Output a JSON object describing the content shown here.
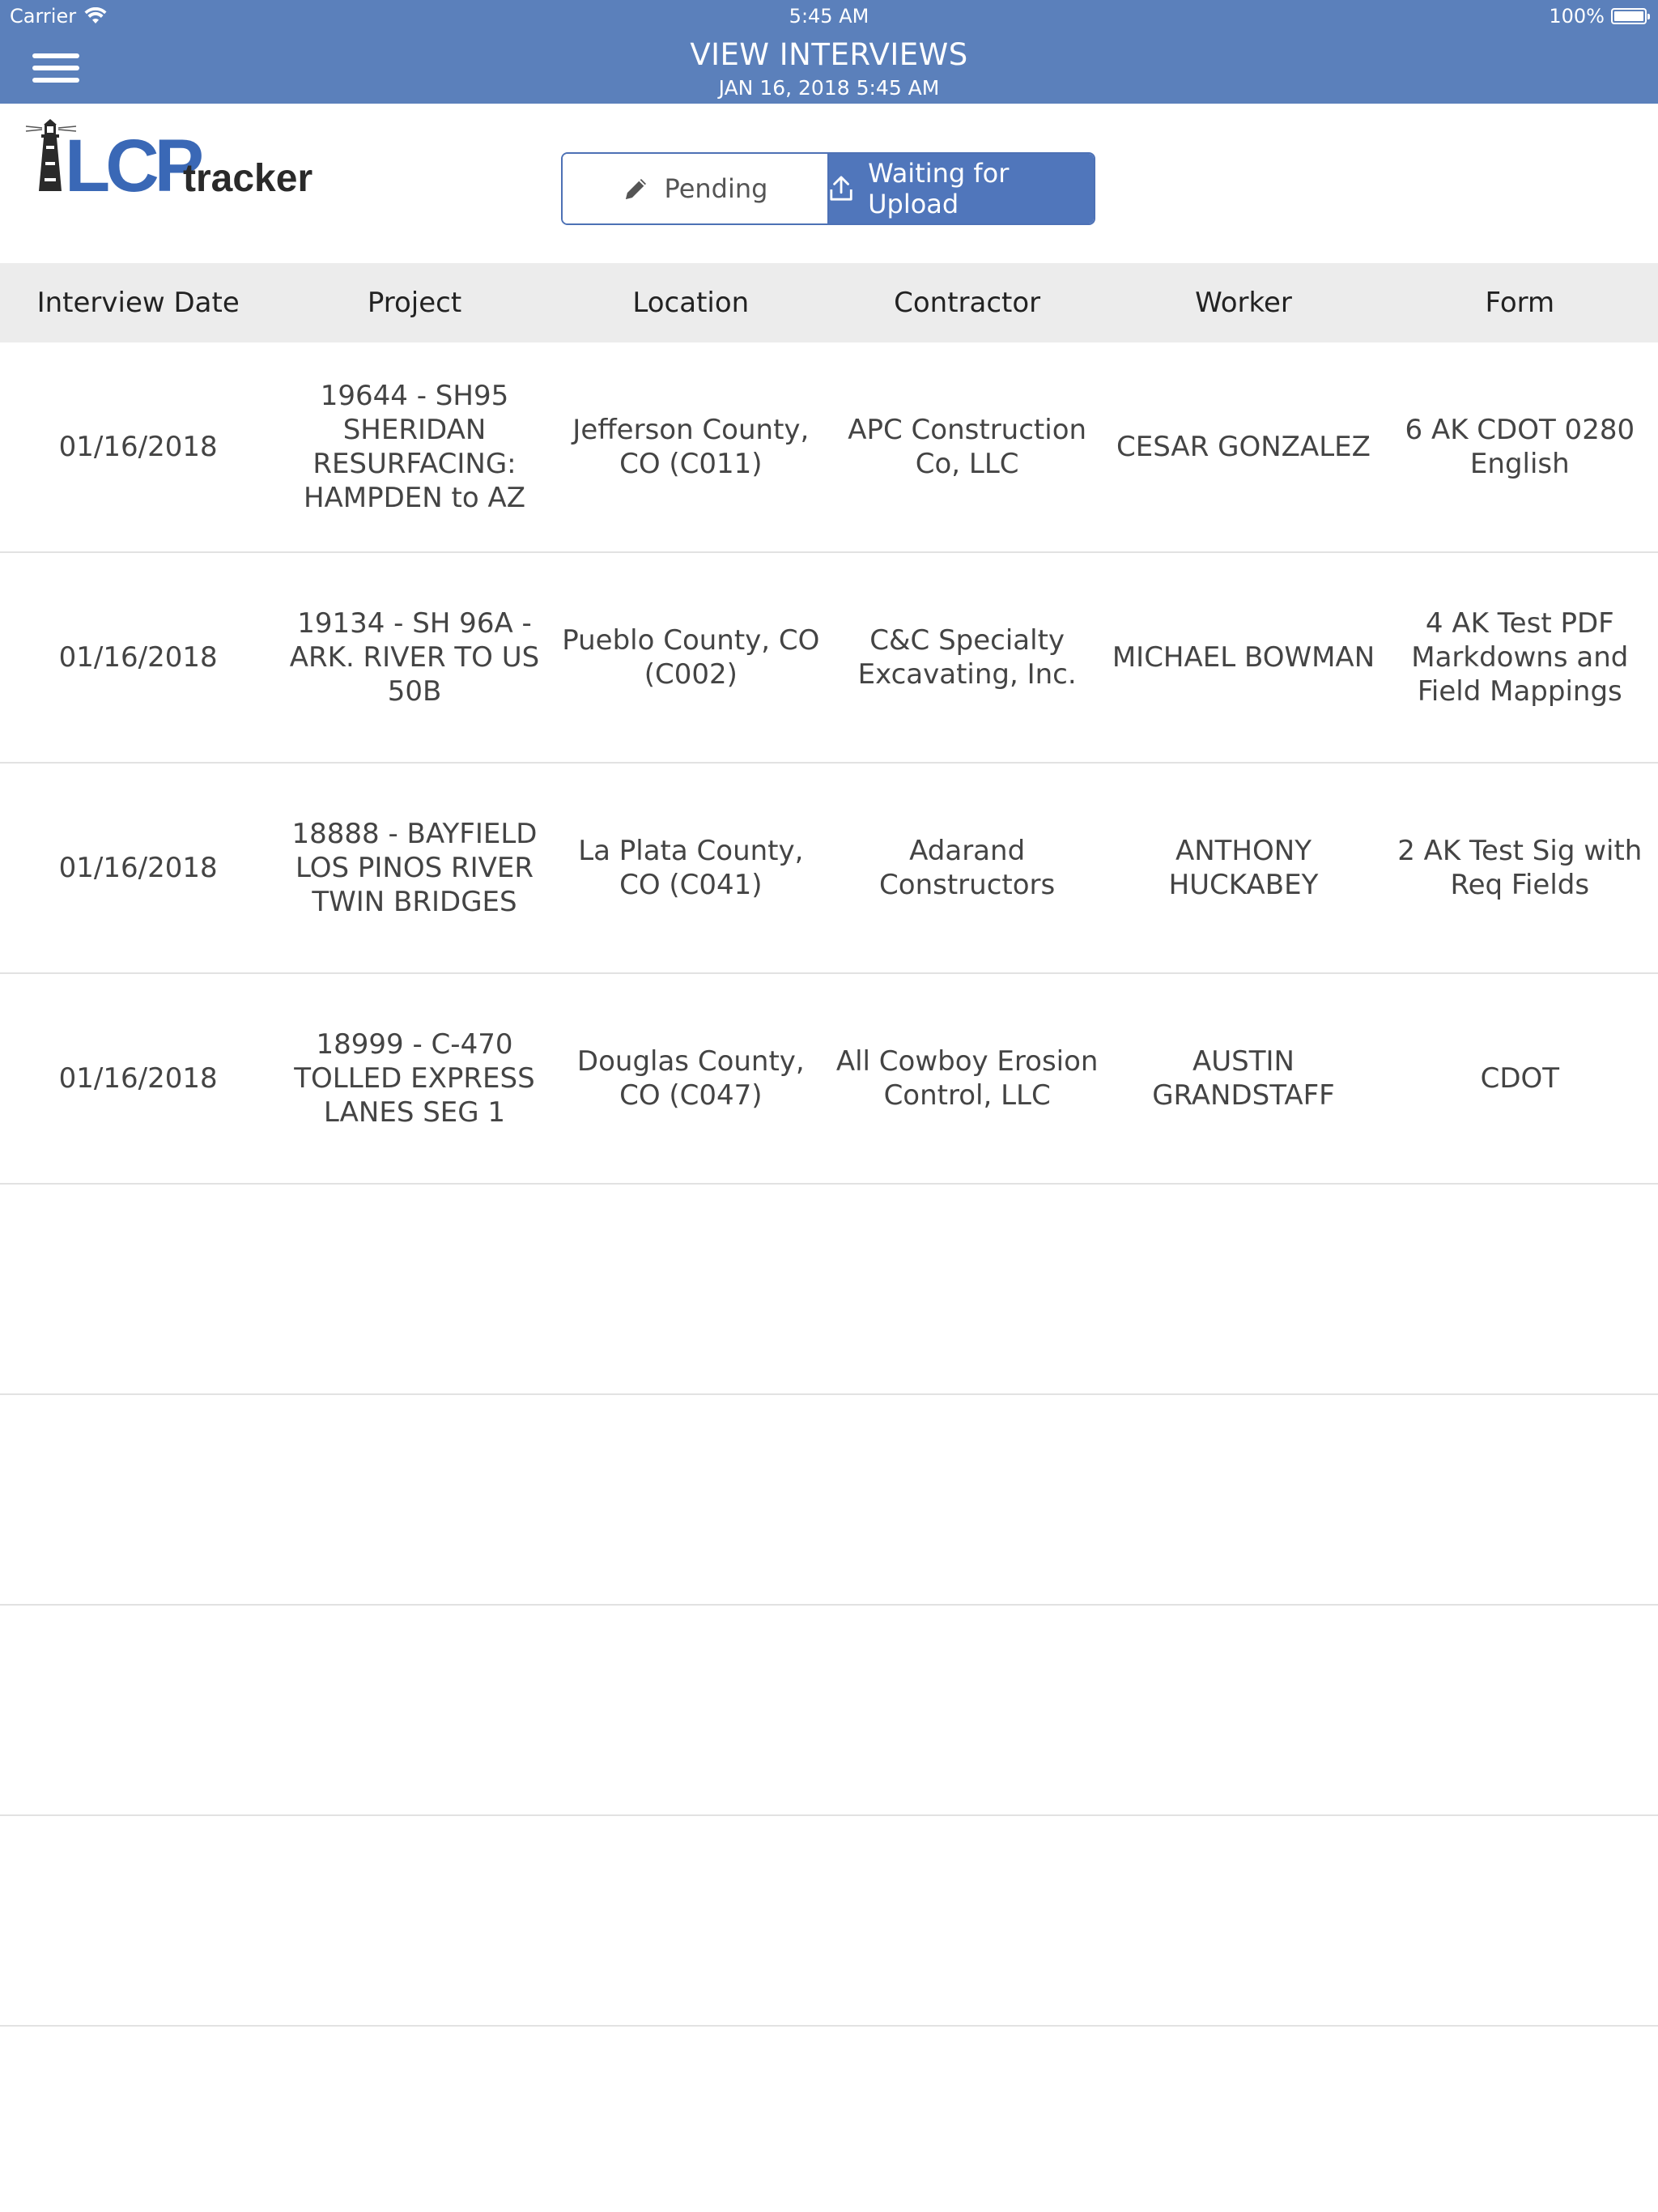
{
  "status_bar": {
    "carrier": "Carrier",
    "time": "5:45 AM",
    "battery": "100%"
  },
  "header": {
    "title": "VIEW INTERVIEWS",
    "subtitle": "JAN 16, 2018 5:45 AM"
  },
  "logo": {
    "text_lcp": "LCP",
    "text_tracker": "tracker"
  },
  "tabs": {
    "pending_label": "Pending",
    "upload_label": "Waiting for Upload"
  },
  "table": {
    "columns": [
      "Interview Date",
      "Project",
      "Location",
      "Contractor",
      "Worker",
      "Form"
    ],
    "rows": [
      {
        "date": "01/16/2018",
        "project": "19644 - SH95 SHERIDAN RESURFACING: HAMPDEN to AZ",
        "location": "Jefferson County, CO (C011)",
        "contractor": "APC Construction Co, LLC",
        "worker": "CESAR GONZALEZ",
        "form": "6 AK CDOT 0280 English"
      },
      {
        "date": "01/16/2018",
        "project": "19134 - SH 96A - ARK. RIVER TO US 50B",
        "location": "Pueblo County, CO (C002)",
        "contractor": "C&C Specialty Excavating, Inc.",
        "worker": "MICHAEL BOWMAN",
        "form": "4 AK Test PDF Markdowns and Field Mappings"
      },
      {
        "date": "01/16/2018",
        "project": "18888 - BAYFIELD LOS PINOS RIVER TWIN BRIDGES",
        "location": "La Plata County, CO (C041)",
        "contractor": "Adarand Constructors",
        "worker": "ANTHONY HUCKABEY",
        "form": "2 AK Test Sig with Req Fields"
      },
      {
        "date": "01/16/2018",
        "project": "18999 - C-470 TOLLED EXPRESS LANES SEG 1",
        "location": "Douglas County, CO (C047)",
        "contractor": "All Cowboy Erosion Control, LLC",
        "worker": "AUSTIN GRANDSTAFF",
        "form": "CDOT"
      }
    ]
  },
  "colors": {
    "header_bg": "#5b80bb",
    "accent": "#5076bb",
    "logo_blue": "#3a68b6",
    "logo_dark": "#2a2a2a"
  }
}
